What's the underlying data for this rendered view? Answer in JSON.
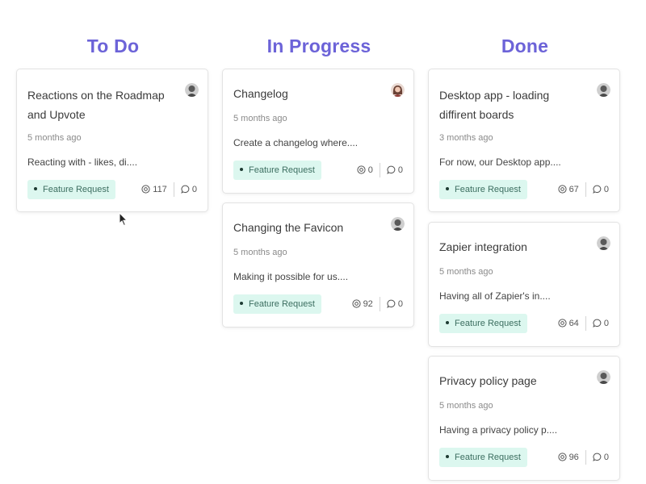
{
  "columns": [
    {
      "title": "To Do",
      "cards": [
        {
          "title": "Reactions on the Roadmap and Upvote",
          "time": "5 months ago",
          "desc": "Reacting with - likes, di....",
          "tag": "Feature Request",
          "views": "117",
          "comments": "0",
          "avatar_color": "#6b6b6b"
        }
      ]
    },
    {
      "title": "In Progress",
      "cards": [
        {
          "title": "Changelog",
          "time": "5 months ago",
          "desc": "Create a changelog where....",
          "tag": "Feature Request",
          "views": "0",
          "comments": "0",
          "avatar_color": "#b07a6a"
        },
        {
          "title": "Changing the Favicon",
          "time": "5 months ago",
          "desc": "Making it possible for us....",
          "tag": "Feature Request",
          "views": "92",
          "comments": "0",
          "avatar_color": "#6b6b6b"
        }
      ]
    },
    {
      "title": "Done",
      "cards": [
        {
          "title": "Desktop app - loading diffirent boards",
          "time": "3 months ago",
          "desc": "For now, our Desktop app....",
          "tag": "Feature Request",
          "views": "67",
          "comments": "0",
          "avatar_color": "#6b6b6b"
        },
        {
          "title": "Zapier integration",
          "time": "5 months ago",
          "desc": "Having all of Zapier's in....",
          "tag": "Feature Request",
          "views": "64",
          "comments": "0",
          "avatar_color": "#6b6b6b"
        },
        {
          "title": "Privacy policy page",
          "time": "5 months ago",
          "desc": "Having a privacy policy p....",
          "tag": "Feature Request",
          "views": "96",
          "comments": "0",
          "avatar_color": "#6b6b6b"
        }
      ]
    }
  ],
  "colors": {
    "column_title": "#6c63d8",
    "tag_bg": "#dcf7ef",
    "tag_text": "#3c6e60"
  },
  "icons": {
    "views": "eye-icon",
    "comments": "comment-icon",
    "cursor": "mouse-pointer-icon"
  }
}
